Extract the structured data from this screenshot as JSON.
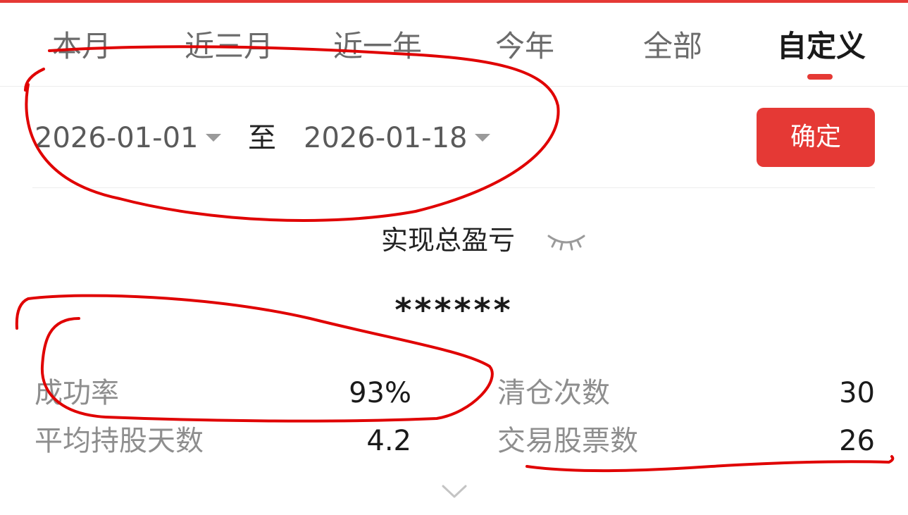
{
  "colors": {
    "accent": "#e53935",
    "annotation": "#e00000"
  },
  "tabs": [
    {
      "label": "本月",
      "active": false
    },
    {
      "label": "近三月",
      "active": false
    },
    {
      "label": "近一年",
      "active": false
    },
    {
      "label": "今年",
      "active": false
    },
    {
      "label": "全部",
      "active": false
    },
    {
      "label": "自定义",
      "active": true
    }
  ],
  "date_range": {
    "start": "2026-01-01",
    "separator": "至",
    "end": "2026-01-18",
    "confirm_label": "确定"
  },
  "summary": {
    "label": "实现总盈亏",
    "value": "******",
    "visibility_icon": "eye-closed-icon"
  },
  "stats": {
    "success_rate": {
      "label": "成功率",
      "value": "93%"
    },
    "clear_count": {
      "label": "清仓次数",
      "value": "30"
    },
    "avg_hold_days": {
      "label": "平均持股天数",
      "value": "4.2"
    },
    "traded_stocks": {
      "label": "交易股票数",
      "value": "26"
    }
  },
  "expand_icon": "chevron-down-icon"
}
